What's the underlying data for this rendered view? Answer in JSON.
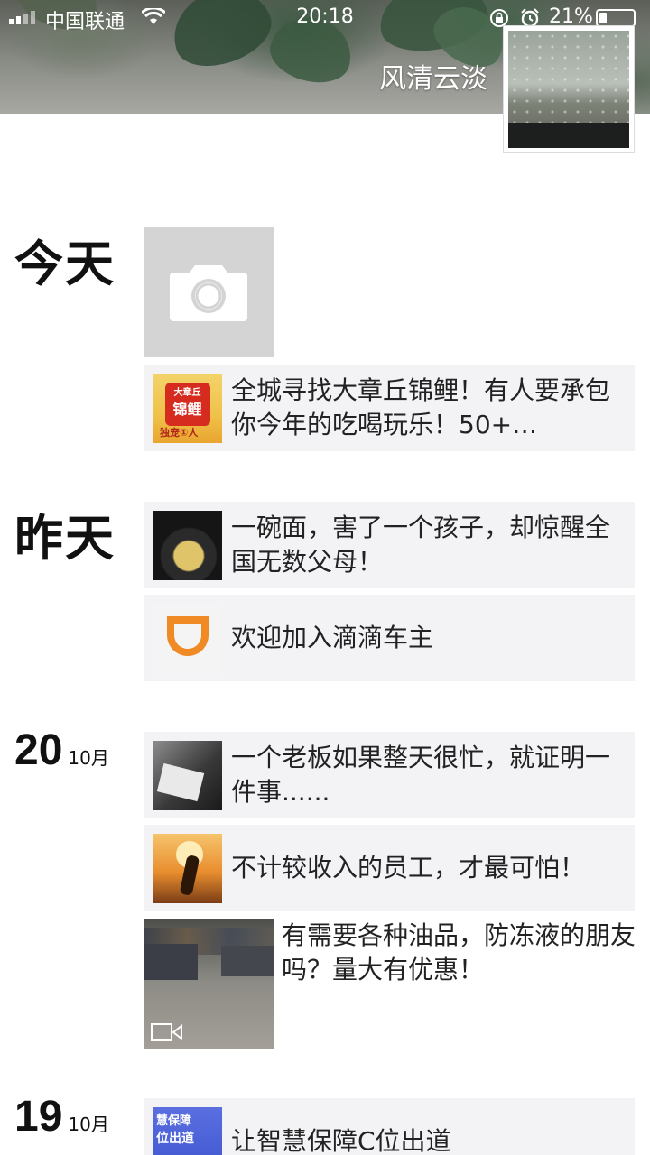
{
  "status_bar": {
    "carrier": "中国联通",
    "time": "20:18",
    "battery_percent_label": "21%",
    "battery_level": 0.21
  },
  "profile": {
    "name": "风清云淡"
  },
  "timeline": {
    "today": {
      "label": "今天",
      "shared_article": {
        "title": "全城寻找大章丘锦鲤！有人要承包你今年的吃喝玩乐！50+…"
      },
      "koi_thumb": {
        "line1": "大章丘",
        "line2": "锦鲤",
        "line3": "独宠①人"
      }
    },
    "yesterday": {
      "label": "昨天",
      "posts": [
        {
          "title": "一碗面，害了一个孩子，却惊醒全国无数父母！"
        },
        {
          "title": "欢迎加入滴滴车主"
        }
      ]
    },
    "oct20": {
      "day": "20",
      "month": "10月",
      "posts": [
        {
          "title": "一个老板如果整天很忙，就证明一件事......"
        },
        {
          "title": "不计较收入的员工，才最可怕！"
        }
      ],
      "video_post": {
        "text": "有需要各种油品，防冻液的朋友吗？量大有优惠！"
      }
    },
    "oct19": {
      "day": "19",
      "month": "10月",
      "posts": [
        {
          "title": "让智慧保障C位出道",
          "thumb_line1": "慧保障",
          "thumb_line2": "位出道"
        }
      ]
    }
  },
  "colors": {
    "card_background": "#f3f3f5",
    "placeholder_gray": "#d4d4d4",
    "didi_orange": "#f08a24"
  },
  "icons": [
    "signal-icon",
    "wifi-icon",
    "rotation-lock-icon",
    "alarm-icon",
    "battery-icon",
    "camera-icon",
    "video-icon"
  ]
}
